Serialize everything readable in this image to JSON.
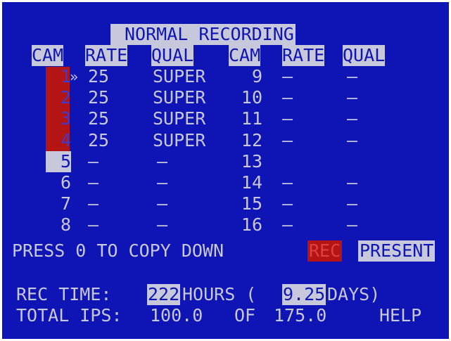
{
  "title": "NORMAL RECORDING",
  "headers": {
    "left": [
      "CAM",
      "RATE",
      "QUAL"
    ],
    "right": [
      "CAM",
      "RATE",
      "QUAL"
    ]
  },
  "left_rows": [
    {
      "cam": "1",
      "marker": "»",
      "rate": "25",
      "qual": "SUPER"
    },
    {
      "cam": "2",
      "marker": "",
      "rate": "25",
      "qual": "SUPER"
    },
    {
      "cam": "3",
      "marker": "",
      "rate": "25",
      "qual": "SUPER"
    },
    {
      "cam": "4",
      "marker": "",
      "rate": "25",
      "qual": "SUPER"
    },
    {
      "cam": "5",
      "marker": "",
      "rate": "–",
      "qual": "–"
    },
    {
      "cam": "6",
      "marker": "",
      "rate": "–",
      "qual": "–"
    },
    {
      "cam": "7",
      "marker": "",
      "rate": "–",
      "qual": "–"
    },
    {
      "cam": "8",
      "marker": "",
      "rate": "–",
      "qual": "–"
    }
  ],
  "right_rows": [
    {
      "cam": "9",
      "rate": "–",
      "qual": "–"
    },
    {
      "cam": "10",
      "rate": "–",
      "qual": "–"
    },
    {
      "cam": "11",
      "rate": "–",
      "qual": "–"
    },
    {
      "cam": "12",
      "rate": "–",
      "qual": "–"
    },
    {
      "cam": "13",
      "rate": "",
      "qual": ""
    },
    {
      "cam": "14",
      "rate": "–",
      "qual": "–"
    },
    {
      "cam": "15",
      "rate": "–",
      "qual": "–"
    },
    {
      "cam": "16",
      "rate": "–",
      "qual": "–"
    }
  ],
  "footer": {
    "copy_hint": "PRESS 0 TO COPY DOWN",
    "rec_label": "REC",
    "present_label": "PRESENT",
    "rec_time_label": "REC TIME:",
    "rec_time_hours": "222",
    "hours_label": "HOURS (",
    "rec_time_days": "9.25",
    "days_label": "DAYS)",
    "total_ips_label": "TOTAL IPS:",
    "ips_value": "100.0",
    "of_label": "OF",
    "ips_max": "175.0",
    "help_label": "HELP"
  },
  "colors": {
    "background": "#0f14b4",
    "text": "#c8c8dc",
    "highlight": "#c8c8dc",
    "recording_red": "#b41414"
  }
}
